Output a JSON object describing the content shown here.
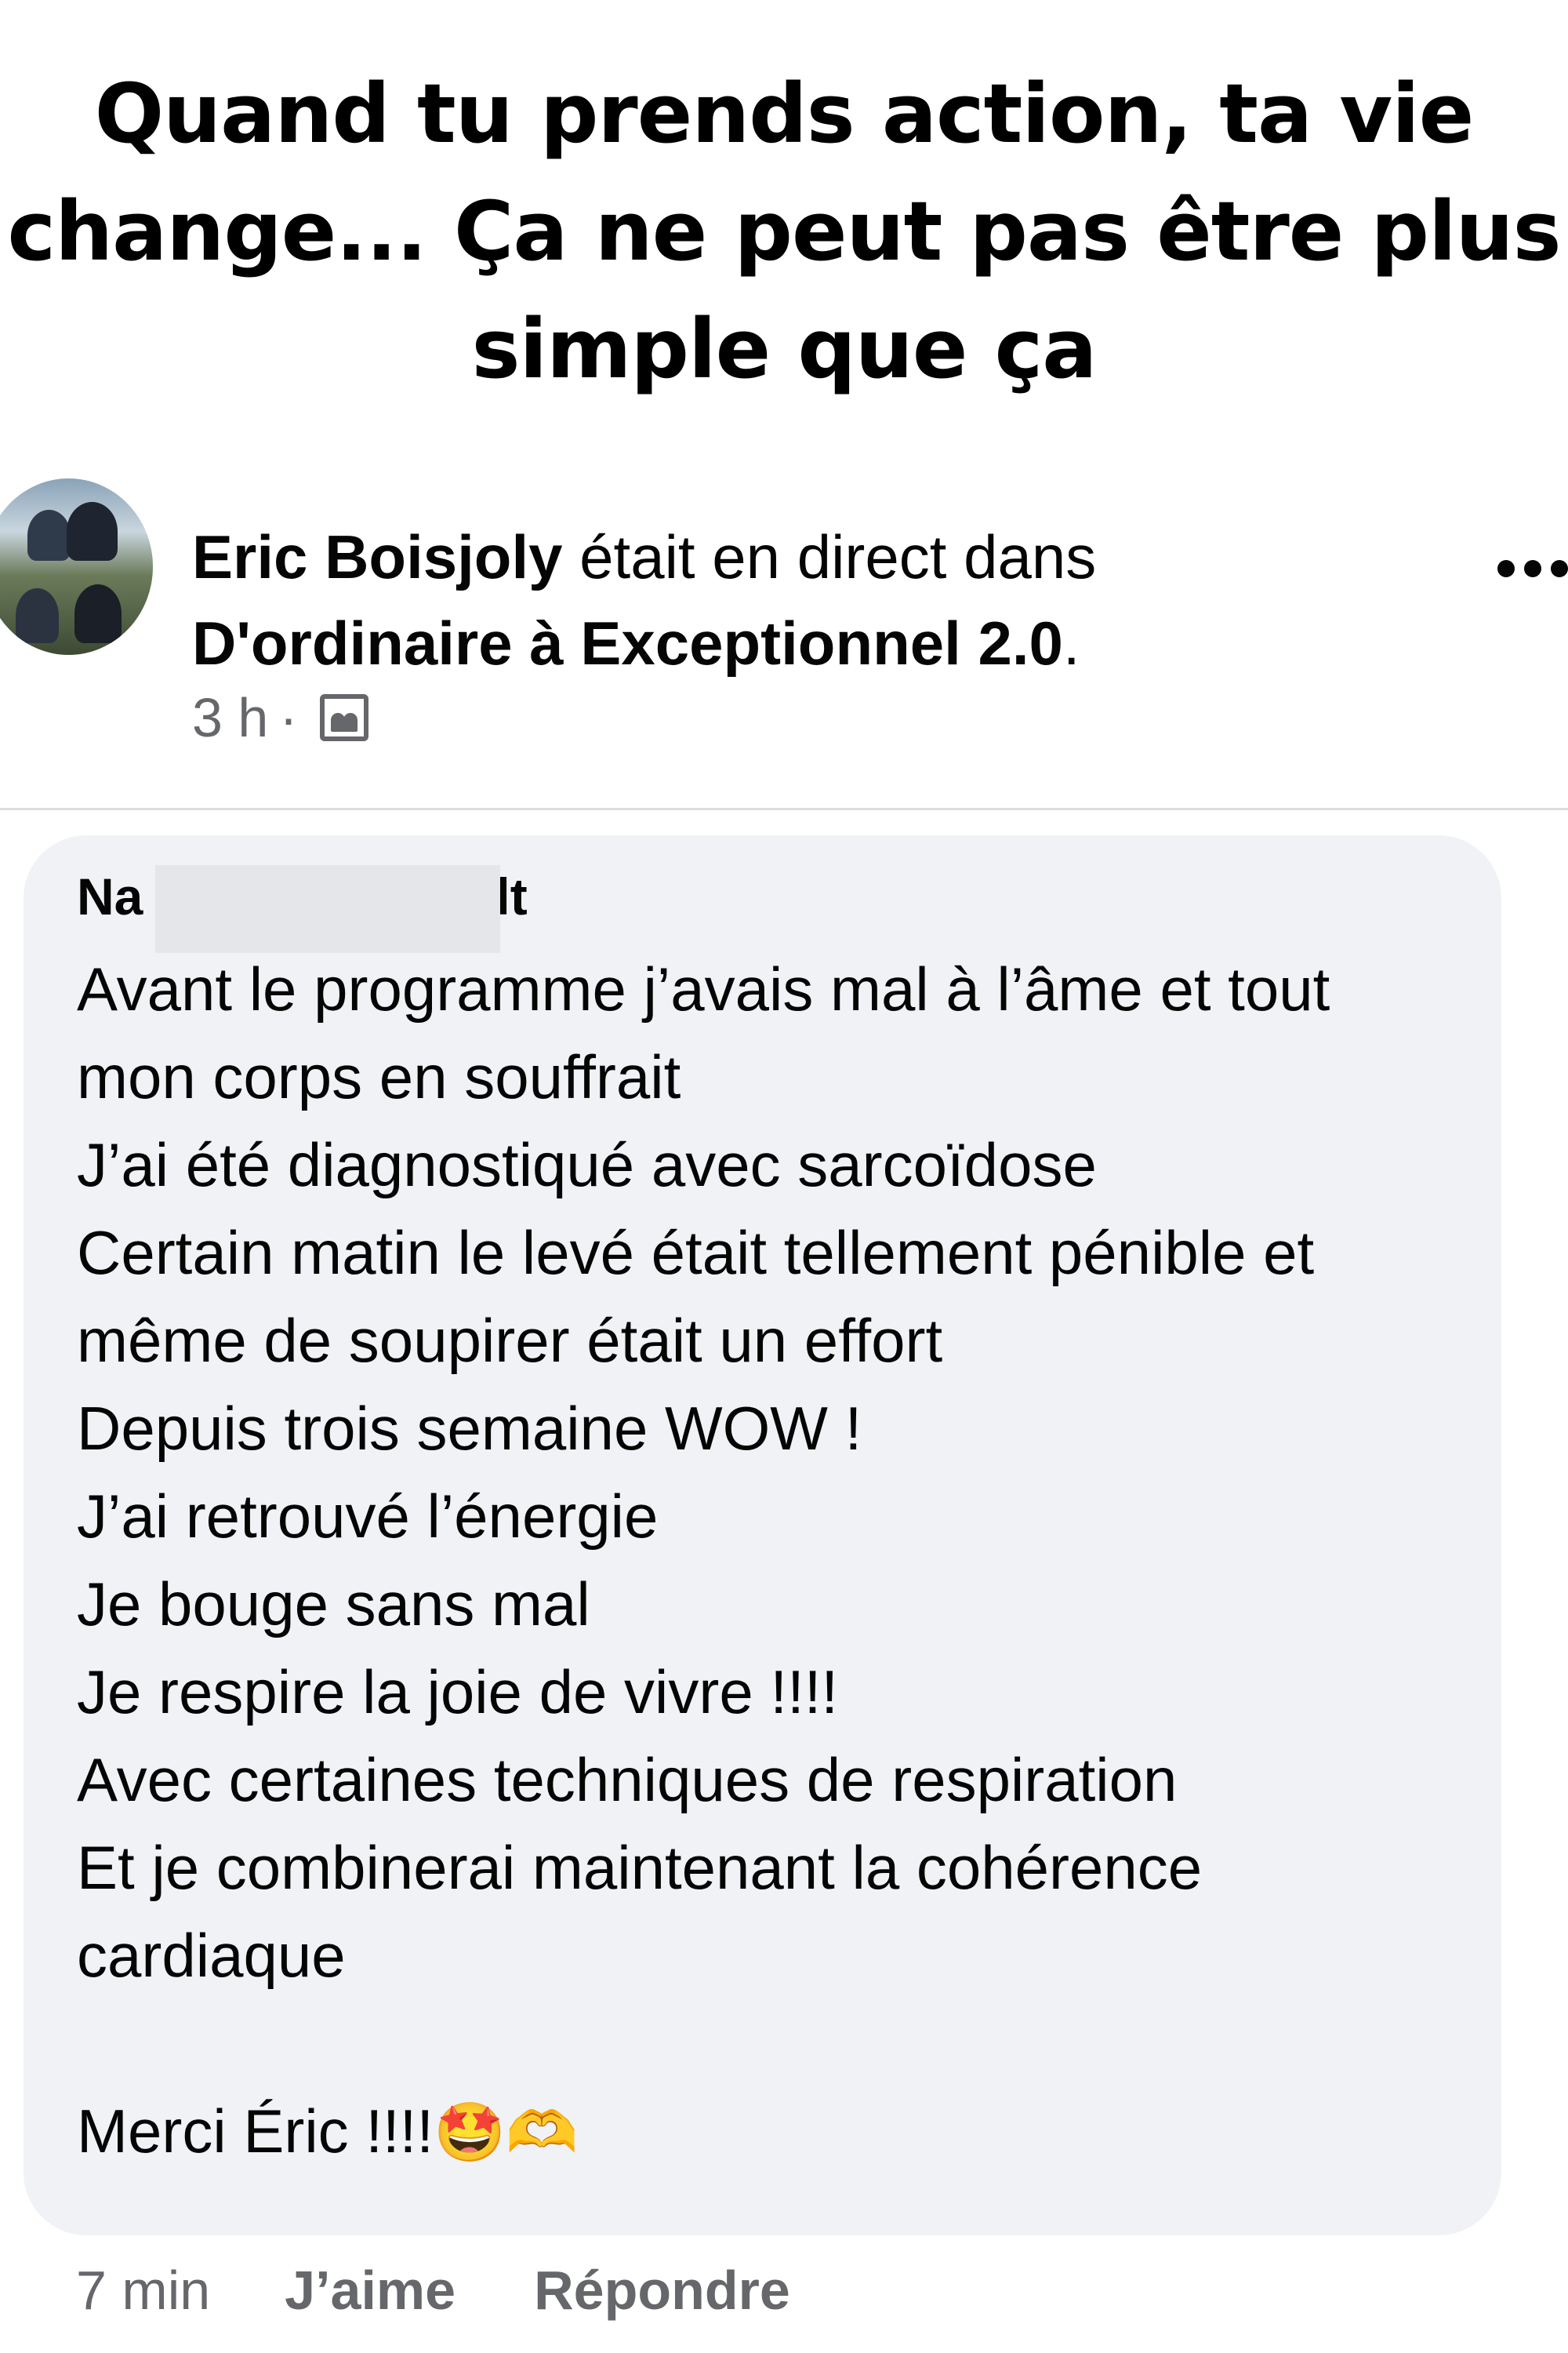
{
  "headline": {
    "line1": "Quand tu prends action, ta vie",
    "line2": "change... Ça ne peut pas être plus",
    "line3": "simple que ça"
  },
  "post": {
    "author": "Eric Boisjoly",
    "action_text": " était en direct dans",
    "group_name": "D'ordinaire à Exceptionnel 2.0",
    "group_suffix": ".",
    "time_ago": "3 h",
    "separator": "·",
    "audience_icon": "group-icon",
    "more_icon": "more-options-icon"
  },
  "comment": {
    "author_prefix": "Na",
    "author_suffix": "lt",
    "lines": [
      "Avant le programme j’avais mal à l’âme et tout",
      "mon corps en souffrait",
      "J’ai été diagnostiqué avec sarcoïdose",
      "Certain matin le levé était tellement pénible et",
      "même de soupirer était un effort",
      "Depuis trois semaine WOW !",
      "J’ai retrouvé l’énergie",
      "Je bouge sans mal",
      "Je respire la joie de vivre !!!!",
      "Avec certaines techniques de respiration",
      "Et je combinerai maintenant la cohérence",
      "cardiaque",
      "",
      "Merci Éric !!!!"
    ],
    "emojis": "🤩🫶",
    "time": "7 min",
    "like_label": "J’aime",
    "reply_label": "Répondre"
  },
  "colors": {
    "bubble_bg": "#f0f2f5",
    "secondary_text": "#65676b",
    "primary_text": "#050505"
  }
}
